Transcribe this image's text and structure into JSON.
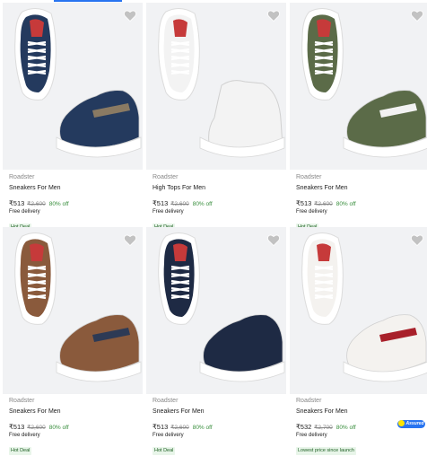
{
  "products": [
    {
      "brand": "Roadster",
      "title": "Sneakers For Men",
      "price": "₹513",
      "mrp": "₹2,600",
      "discount": "80% off",
      "delivery": "Free delivery",
      "tag": "Hot Deal",
      "assured": false,
      "shoe_color": "#243a5e",
      "accent": "#8a7a63"
    },
    {
      "brand": "Roadster",
      "title": "High Tops For Men",
      "price": "₹513",
      "mrp": "₹2,600",
      "discount": "80% off",
      "delivery": "Free delivery",
      "tag": "Hot Deal",
      "assured": false,
      "shoe_color": "#f3f3f3",
      "accent": "#d9d9d9"
    },
    {
      "brand": "Roadster",
      "title": "Sneakers For Men",
      "price": "₹513",
      "mrp": "₹2,600",
      "discount": "80% off",
      "delivery": "Free delivery",
      "tag": "Hot Deal",
      "assured": false,
      "shoe_color": "#5b6b48",
      "accent": "#f2f2f2"
    },
    {
      "brand": "Roadster",
      "title": "Sneakers For Men",
      "price": "₹513",
      "mrp": "₹2,600",
      "discount": "80% off",
      "delivery": "Free delivery",
      "tag": "Hot Deal",
      "assured": false,
      "shoe_color": "#8a5a3c",
      "accent": "#2d3a55"
    },
    {
      "brand": "Roadster",
      "title": "Sneakers For Men",
      "price": "₹513",
      "mrp": "₹2,600",
      "discount": "80% off",
      "delivery": "Free delivery",
      "tag": "Hot Deal",
      "assured": false,
      "shoe_color": "#1e2a44",
      "accent": "#1e2a44"
    },
    {
      "brand": "Roadster",
      "title": "Sneakers For Men",
      "price": "₹532",
      "mrp": "₹2,700",
      "discount": "80% off",
      "delivery": "Free delivery",
      "tag": "Lowest price since launch",
      "assured": true,
      "assured_label": "Assured",
      "shoe_color": "#f4f2ef",
      "accent": "#a8202a"
    }
  ],
  "icons": {
    "wishlist": "heart-icon",
    "assured": "assured-badge-icon"
  },
  "colors": {
    "accent": "#2874f0",
    "discount": "#388e3c",
    "tag_bg": "#e8f5e9",
    "muted": "#878787"
  }
}
